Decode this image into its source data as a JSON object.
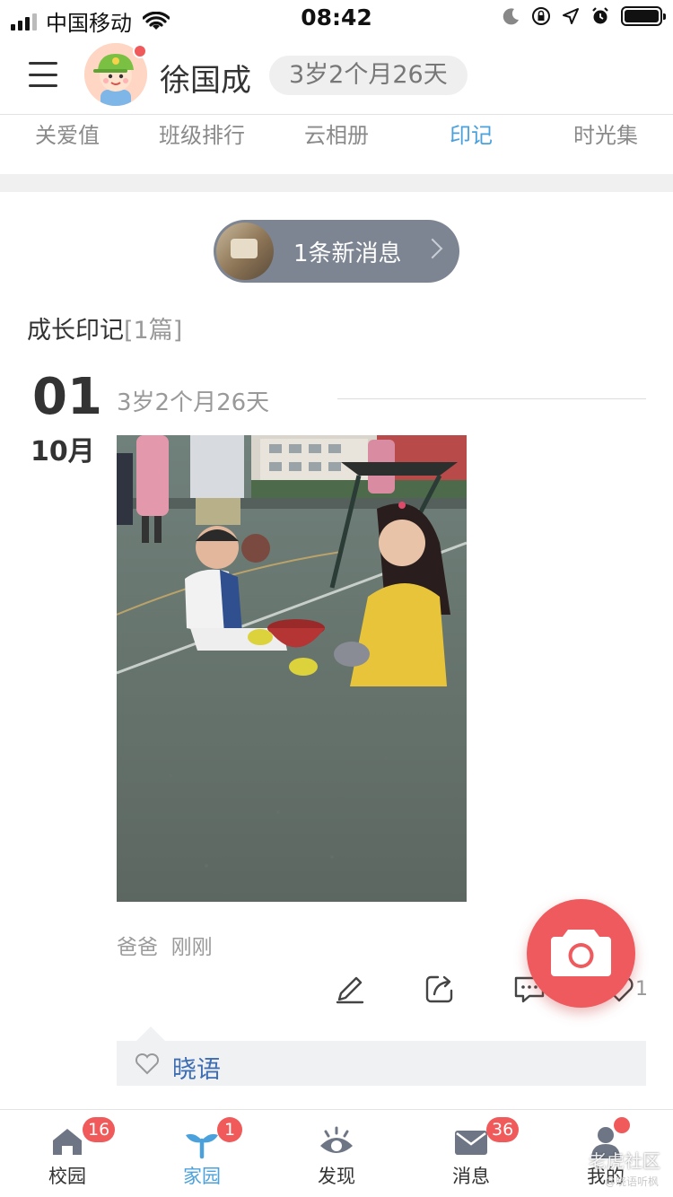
{
  "status_bar": {
    "carrier": "中国移动",
    "time": "08:42"
  },
  "header": {
    "child_name": "徐国成",
    "age": "3岁2个月26天"
  },
  "tabs": [
    {
      "label": "关爱值",
      "active": false
    },
    {
      "label": "班级排行",
      "active": false
    },
    {
      "label": "云相册",
      "active": false
    },
    {
      "label": "印记",
      "active": true
    },
    {
      "label": "时光集",
      "active": false
    }
  ],
  "new_message": {
    "label": "1条新消息"
  },
  "section": {
    "title": "成长印记",
    "count": "[1篇]"
  },
  "entry": {
    "day": "01",
    "month": "10月",
    "age": "3岁2个月26天",
    "author": "爸爸",
    "time": "刚刚",
    "like_count": "1",
    "comment_liker": "晓语"
  },
  "bottom_nav": [
    {
      "label": "校园",
      "badge": "16",
      "icon": "school-icon"
    },
    {
      "label": "家园",
      "badge": "1",
      "icon": "sprout-icon",
      "active": true
    },
    {
      "label": "发现",
      "badge": "",
      "icon": "eye-icon"
    },
    {
      "label": "消息",
      "badge": "36",
      "icon": "mail-icon"
    },
    {
      "label": "我的",
      "badge": "dot",
      "icon": "user-icon"
    }
  ],
  "watermark": {
    "main": "老虎社区",
    "sub": "@晓语听枫"
  },
  "colors": {
    "accent": "#4ba1dc",
    "badge": "#f05a5a",
    "camera": "#ee5a5e",
    "pill": "#7d8593"
  }
}
